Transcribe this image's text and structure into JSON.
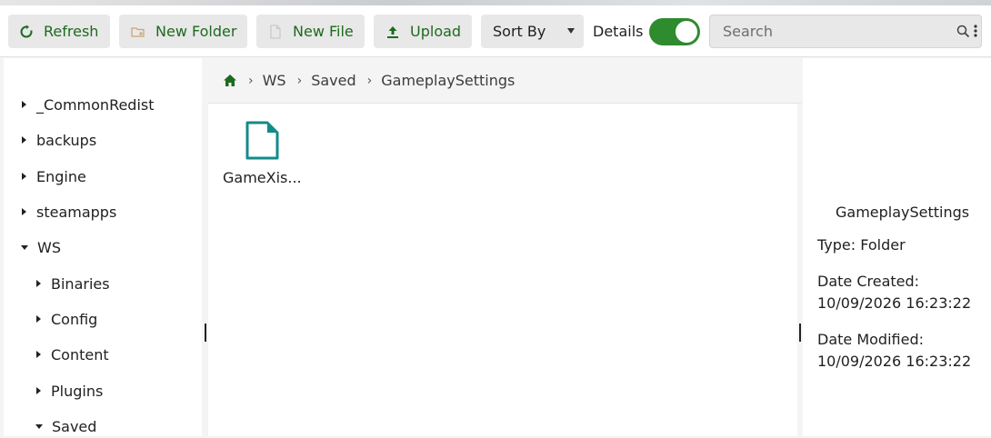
{
  "toolbar": {
    "refresh_label": "Refresh",
    "new_folder_label": "New Folder",
    "new_file_label": "New File",
    "upload_label": "Upload",
    "sort_label": "Sort By",
    "details_label": "Details",
    "details_on": true,
    "search_placeholder": "Search"
  },
  "sidebar": {
    "items": [
      {
        "label": "_CommonRedist",
        "expanded": false
      },
      {
        "label": "backups",
        "expanded": false
      },
      {
        "label": "Engine",
        "expanded": false
      },
      {
        "label": "steamapps",
        "expanded": false
      },
      {
        "label": "WS",
        "expanded": true
      },
      {
        "label": "Binaries",
        "expanded": false
      },
      {
        "label": "Config",
        "expanded": false
      },
      {
        "label": "Content",
        "expanded": false
      },
      {
        "label": "Plugins",
        "expanded": false
      },
      {
        "label": "Saved",
        "expanded": true
      }
    ]
  },
  "breadcrumb": [
    "WS",
    "Saved",
    "GameplaySettings"
  ],
  "files": [
    {
      "name": "GameXis...",
      "type": "file"
    }
  ],
  "details": {
    "title": "GameplaySettings",
    "type_line": "Type: Folder",
    "created_label": "Date Created:",
    "created_value": "10/09/2026 16:23:22",
    "modified_label": "Date Modified:",
    "modified_value": "10/09/2026 16:23:22"
  },
  "colors": {
    "accent": "#2e8b2e",
    "file_icon": "#138a8a",
    "home_icon": "#1e6a1e"
  }
}
